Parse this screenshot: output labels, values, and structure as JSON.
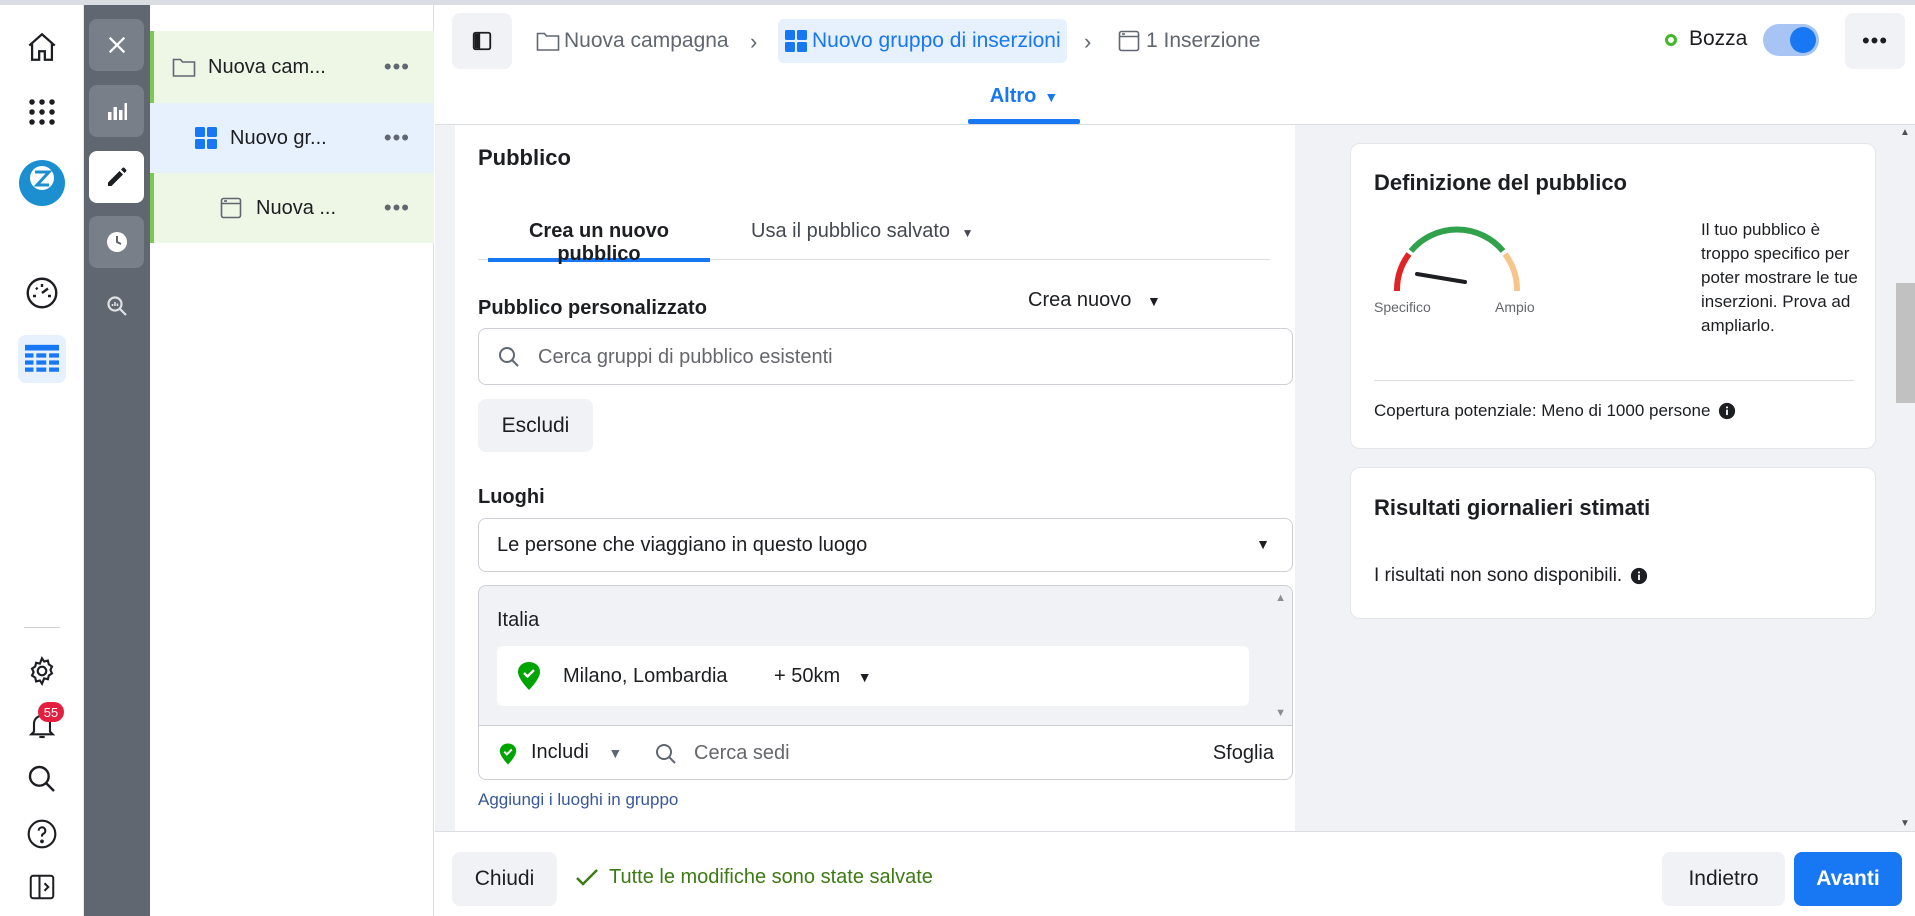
{
  "rail": {
    "notifications_count": "55"
  },
  "tree": {
    "campaign_label": "Nuova cam...",
    "adset_label": "Nuovo gr...",
    "ad_label": "Nuova ...",
    "more_label": "•••"
  },
  "header": {
    "crumb_campaign": "Nuova campagna",
    "crumb_adset": "Nuovo gruppo di inserzioni",
    "crumb_ad": "1 Inserzione",
    "status": "Bozza",
    "more_label": "•••",
    "altro_label": "Altro"
  },
  "audience": {
    "section_title": "Pubblico",
    "tab_new": "Crea un nuovo pubblico",
    "tab_saved": "Usa il pubblico salvato",
    "custom_title": "Pubblico personalizzato",
    "create_new": "Crea nuovo",
    "search_placeholder": "Cerca gruppi di pubblico esistenti",
    "exclude_label": "Escludi",
    "locations_title": "Luoghi",
    "location_mode": "Le persone che viaggiano in questo luogo",
    "country": "Italia",
    "city": "Milano, Lombardia",
    "radius": "+ 50km",
    "include_label": "Includi",
    "search_places_placeholder": "Cerca sedi",
    "browse_label": "Sfoglia",
    "bulk_link": "Aggiungi i luoghi in gruppo"
  },
  "definition": {
    "title": "Definizione del pubblico",
    "gauge_left": "Specifico",
    "gauge_right": "Ampio",
    "description": "Il tuo pubblico è troppo specifico per poter mostrare le tue inserzioni. Prova ad ampliarlo.",
    "reach": "Copertura potenziale: Meno di 1000 persone"
  },
  "estimates": {
    "title": "Risultati giornalieri stimati",
    "text": "I risultati non sono disponibili."
  },
  "footer": {
    "close_label": "Chiudi",
    "saved_text": "Tutte le modifiche sono state salvate",
    "back_label": "Indietro",
    "next_label": "Avanti"
  },
  "colors": {
    "accent": "#1877f2",
    "success": "#42b72a",
    "saved_text": "#3c7a14"
  }
}
